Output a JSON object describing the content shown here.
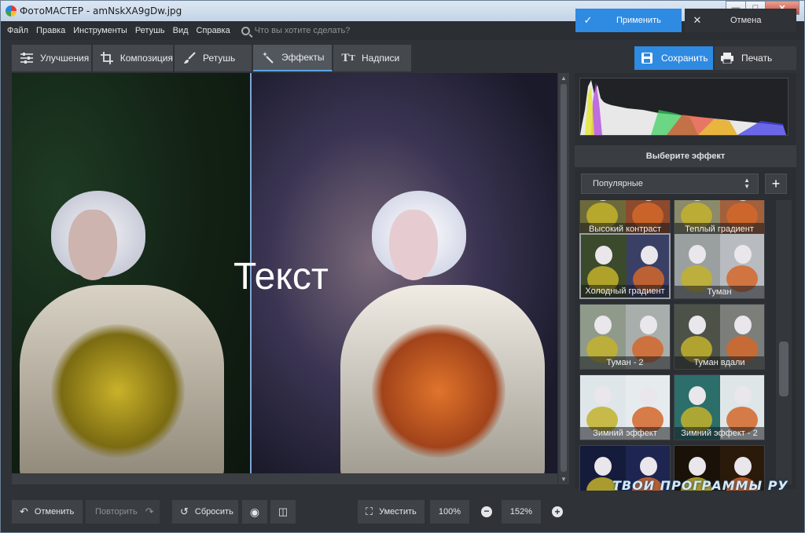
{
  "window": {
    "title": "ФотоМАСТЕР - amNskXA9gDw.jpg"
  },
  "menu": {
    "items": [
      "Файл",
      "Правка",
      "Инструменты",
      "Ретушь",
      "Вид",
      "Справка"
    ],
    "search_placeholder": "Что вы хотите сделать?"
  },
  "toolbar": {
    "tabs": [
      {
        "label": "Улучшения",
        "icon": "sliders-icon"
      },
      {
        "label": "Композиция",
        "icon": "crop-icon"
      },
      {
        "label": "Ретушь",
        "icon": "brush-icon"
      },
      {
        "label": "Эффекты",
        "icon": "magic-wand-icon",
        "active": true
      },
      {
        "label": "Надписи",
        "icon": "text-icon"
      }
    ],
    "save_label": "Сохранить",
    "print_label": "Печать"
  },
  "canvas": {
    "overlay_text": "Текст"
  },
  "effects_panel": {
    "header": "Выберите эффект",
    "category": "Популярные",
    "effects": [
      {
        "label": "Высокий контраст"
      },
      {
        "label": "Теплый градиент"
      },
      {
        "label": "Холодный градиент",
        "selected": true
      },
      {
        "label": "Туман"
      },
      {
        "label": "Туман - 2"
      },
      {
        "label": "Туман вдали"
      },
      {
        "label": "Зимний эффект"
      },
      {
        "label": "Зимний эффект - 2"
      },
      {
        "label": ""
      },
      {
        "label": ""
      }
    ]
  },
  "bottombar": {
    "undo_label": "Отменить",
    "redo_label": "Повторить",
    "reset_label": "Сбросить",
    "fit_label": "Уместить",
    "zoom_preset": "100%",
    "zoom_value": "152%",
    "apply_label": "Применить",
    "cancel_label": "Отмена"
  },
  "watermark": "ТВОИ ПРОГРАММЫ РУ",
  "colors": {
    "accent": "#2f8ae2",
    "panel": "#2f3236"
  }
}
